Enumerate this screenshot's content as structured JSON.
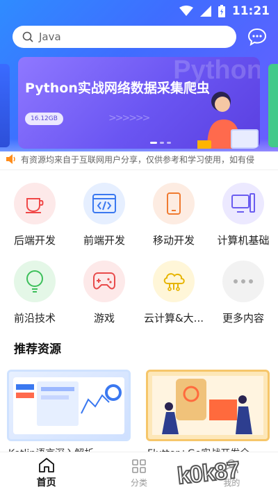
{
  "status_bar": {
    "time": "11:21"
  },
  "search": {
    "placeholder": "Java"
  },
  "banner": {
    "title": "Python实战网络数据采集爬虫",
    "watermark": "Python",
    "size": "16.12GB"
  },
  "notice": {
    "text": "有资源均来自于互联网用户分享，仅供参考和学习使用，如有侵"
  },
  "categories": [
    {
      "label": "后端开发",
      "icon": "coffee-cup-icon",
      "color": "#f04848",
      "bg": "#fde9e9"
    },
    {
      "label": "前端开发",
      "icon": "code-window-icon",
      "color": "#3a78f0",
      "bg": "#e6efff"
    },
    {
      "label": "移动开发",
      "icon": "smartphone-icon",
      "color": "#f07a30",
      "bg": "#fdece2"
    },
    {
      "label": "计算机基础",
      "icon": "computer-icon",
      "color": "#6a5cf0",
      "bg": "#ece9ff"
    },
    {
      "label": "前沿技术",
      "icon": "lightbulb-icon",
      "color": "#3cbf5a",
      "bg": "#e4f7e7"
    },
    {
      "label": "游戏",
      "icon": "gamepad-icon",
      "color": "#e84a4a",
      "bg": "#fde9e9"
    },
    {
      "label": "云计算&大...",
      "icon": "cloud-icon",
      "color": "#e6b400",
      "bg": "#fff6d8"
    },
    {
      "label": "更多内容",
      "icon": "more-dots-icon",
      "color": "#b0b0b0",
      "bg": "#f2f2f2"
    }
  ],
  "section": {
    "title": "推荐资源"
  },
  "cards": [
    {
      "title": "Kotlin语言深入解析"
    },
    {
      "title": "Flutter+Go实战开发全"
    }
  ],
  "bottom_nav": [
    {
      "label": "首页",
      "icon": "home-icon",
      "active": true
    },
    {
      "label": "分类",
      "icon": "grid-icon",
      "active": false
    },
    {
      "label": "我的",
      "icon": "profile-icon",
      "active": false
    }
  ],
  "watermark": "k0k87"
}
